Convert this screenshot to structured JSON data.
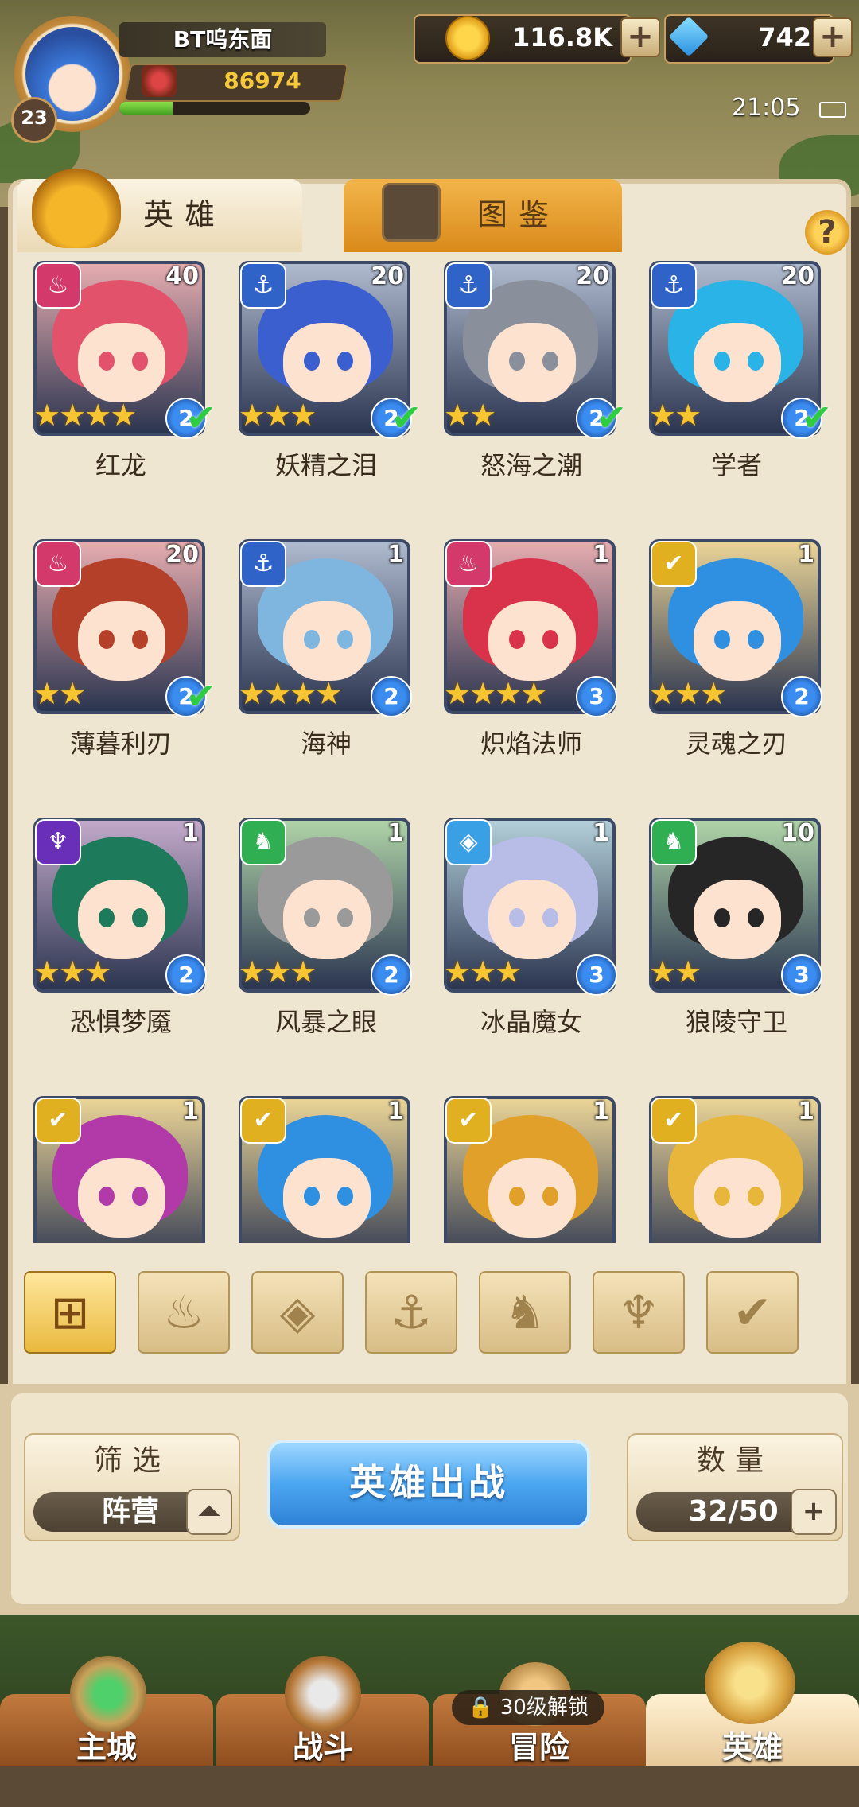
{
  "player": {
    "name": "BT呜东面",
    "level": "23",
    "power": "86974",
    "exp_progress": 0.28
  },
  "resources": {
    "gold": "116.8K",
    "gems": "742"
  },
  "status_bar": {
    "time": "21:05"
  },
  "tabs": [
    {
      "label": "英雄",
      "active": true
    },
    {
      "label": "图鉴",
      "active": false
    }
  ],
  "help_label": "?",
  "heroes": [
    {
      "name": "红龙",
      "level": "40",
      "stars": 4,
      "grade": "2",
      "checked": true,
      "faction": "fire",
      "hair": "#e2536b"
    },
    {
      "name": "妖精之泪",
      "level": "20",
      "stars": 3,
      "grade": "2",
      "checked": true,
      "faction": "water",
      "hair": "#3c5fcf"
    },
    {
      "name": "怒海之潮",
      "level": "20",
      "stars": 2,
      "grade": "2",
      "checked": true,
      "faction": "water",
      "hair": "#8a8f9c"
    },
    {
      "name": "学者",
      "level": "20",
      "stars": 2,
      "grade": "2",
      "checked": true,
      "faction": "water",
      "hair": "#2ab3e6"
    },
    {
      "name": "薄暮利刃",
      "level": "20",
      "stars": 2,
      "grade": "2",
      "checked": true,
      "faction": "fire",
      "hair": "#b5402a"
    },
    {
      "name": "海神",
      "level": "1",
      "stars": 4,
      "grade": "2",
      "checked": false,
      "faction": "water",
      "hair": "#7fb6e0"
    },
    {
      "name": "炽焰法师",
      "level": "1",
      "stars": 4,
      "grade": "3",
      "checked": false,
      "faction": "fire",
      "hair": "#d8334a"
    },
    {
      "name": "灵魂之刃",
      "level": "1",
      "stars": 3,
      "grade": "2",
      "checked": false,
      "faction": "light",
      "hair": "#2f8fe0"
    },
    {
      "name": "恐惧梦魇",
      "level": "1",
      "stars": 3,
      "grade": "2",
      "checked": false,
      "faction": "dark",
      "hair": "#1d7a5a"
    },
    {
      "name": "风暴之眼",
      "level": "1",
      "stars": 3,
      "grade": "2",
      "checked": false,
      "faction": "nature",
      "hair": "#9a9a9a"
    },
    {
      "name": "冰晶魔女",
      "level": "1",
      "stars": 3,
      "grade": "3",
      "checked": false,
      "faction": "ice",
      "hair": "#b8bde8"
    },
    {
      "name": "狼陵守卫",
      "level": "10",
      "stars": 2,
      "grade": "3",
      "checked": false,
      "faction": "nature",
      "hair": "#262626"
    },
    {
      "name": "",
      "level": "1",
      "stars": 0,
      "grade": "",
      "checked": false,
      "faction": "light",
      "hair": "#b23aa8"
    },
    {
      "name": "",
      "level": "1",
      "stars": 0,
      "grade": "",
      "checked": false,
      "faction": "light",
      "hair": "#2f8fe0"
    },
    {
      "name": "",
      "level": "1",
      "stars": 0,
      "grade": "",
      "checked": false,
      "faction": "light",
      "hair": "#e0a02a"
    },
    {
      "name": "",
      "level": "1",
      "stars": 0,
      "grade": "",
      "checked": false,
      "faction": "light",
      "hair": "#e8b63a"
    }
  ],
  "faction_colors": {
    "fire": "#d33a6b",
    "water": "#2f63c8",
    "light": "#e0b020",
    "dark": "#6a2fb8",
    "nature": "#2fae52",
    "ice": "#3aa0e6"
  },
  "faction_glyphs": {
    "fire": "♨",
    "water": "⚓",
    "light": "✔",
    "dark": "♆",
    "nature": "♞",
    "ice": "◈"
  },
  "filters": [
    {
      "icon": "grid-icon",
      "glyph": "⊞",
      "active": true
    },
    {
      "icon": "flame-icon",
      "glyph": "♨",
      "active": false
    },
    {
      "icon": "diamond-icon",
      "glyph": "◈",
      "active": false
    },
    {
      "icon": "anchor-icon",
      "glyph": "⚓",
      "active": false
    },
    {
      "icon": "beast-icon",
      "glyph": "♞",
      "active": false
    },
    {
      "icon": "horns-icon",
      "glyph": "♆",
      "active": false
    },
    {
      "icon": "wings-icon",
      "glyph": "✔",
      "active": false
    }
  ],
  "filter_box": {
    "title": "筛选",
    "value": "阵营",
    "toggle": "⏶"
  },
  "deploy_button": "英雄出战",
  "count_box": {
    "title": "数量",
    "value": "32/50",
    "add": "+"
  },
  "nav": [
    {
      "label": "主城",
      "icon": "castle-icon"
    },
    {
      "label": "战斗",
      "icon": "crossed-swords-icon"
    },
    {
      "label": "冒险",
      "icon": "adventure-icon"
    },
    {
      "label": "英雄",
      "icon": "hero-helmet-icon"
    }
  ],
  "lock_badge": "30级解锁"
}
